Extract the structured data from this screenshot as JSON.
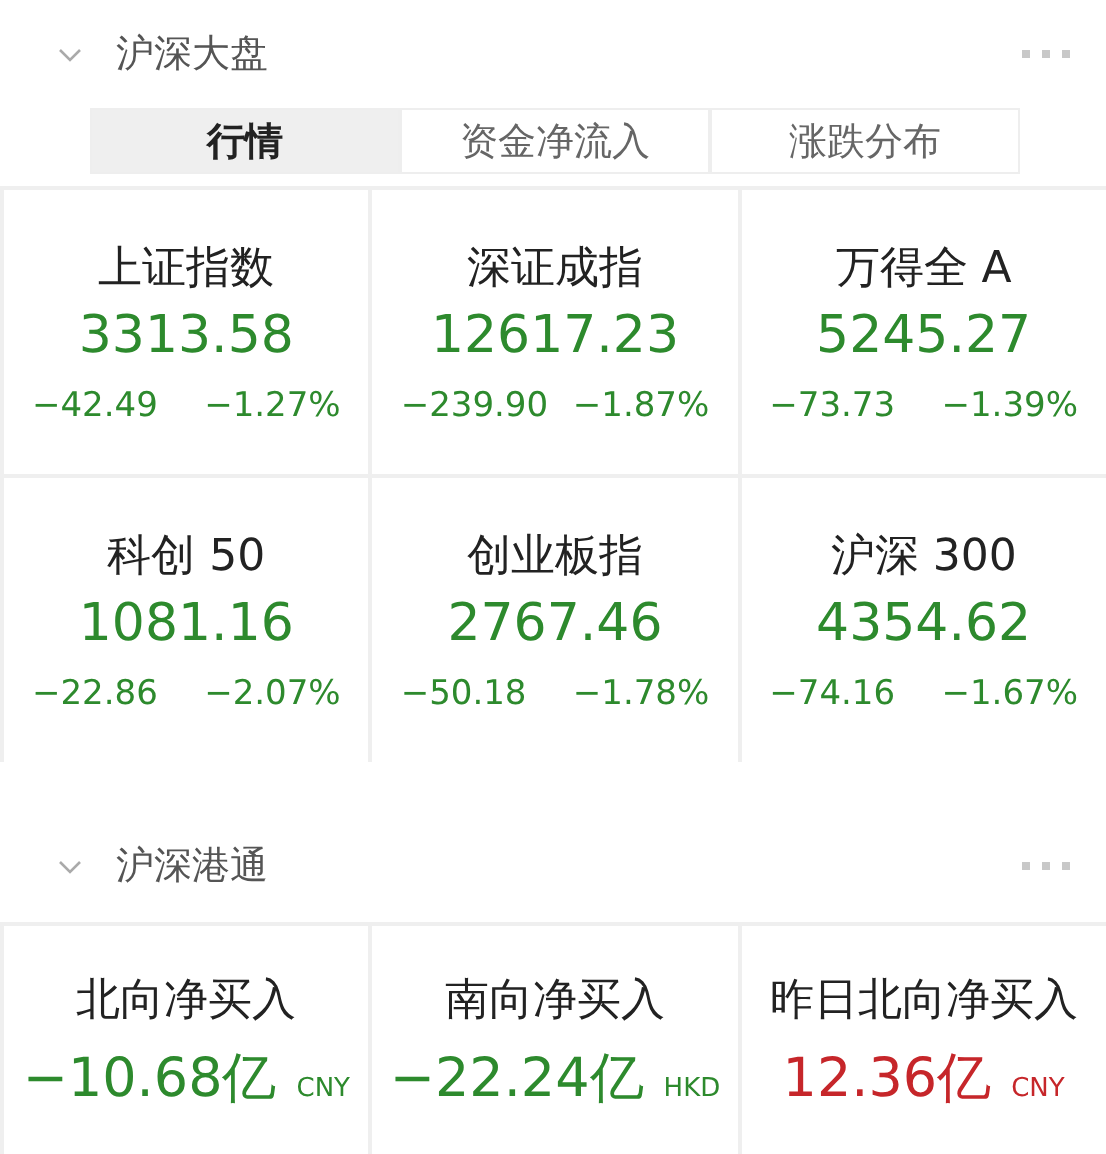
{
  "market": {
    "title": "沪深大盘",
    "expanded": true,
    "tabs": [
      {
        "label": "行情",
        "selected": true
      },
      {
        "label": "资金净流入",
        "selected": false
      },
      {
        "label": "涨跌分布",
        "selected": false
      }
    ],
    "indices": [
      {
        "name": "上证指数",
        "value": "3313.58",
        "change": "−42.49",
        "percent": "−1.27%",
        "color": "#2d8a2d"
      },
      {
        "name": "深证成指",
        "value": "12617.23",
        "change": "−239.90",
        "percent": "−1.87%",
        "color": "#2d8a2d"
      },
      {
        "name": "万得全 A",
        "value": "5245.27",
        "change": "−73.73",
        "percent": "−1.39%",
        "color": "#2d8a2d"
      },
      {
        "name": "科创 50",
        "value": "1081.16",
        "change": "−22.86",
        "percent": "−2.07%",
        "color": "#2d8a2d"
      },
      {
        "name": "创业板指",
        "value": "2767.46",
        "change": "−50.18",
        "percent": "−1.78%",
        "color": "#2d8a2d"
      },
      {
        "name": "沪深 300",
        "value": "4354.62",
        "change": "−74.16",
        "percent": "−1.67%",
        "color": "#2d8a2d"
      }
    ]
  },
  "connect": {
    "title": "沪深港通",
    "expanded": true,
    "flows": [
      {
        "name": "北向净买入",
        "value": "−10.68亿",
        "currency": "CNY",
        "color": "#2d8a2d"
      },
      {
        "name": "南向净买入",
        "value": "−22.24亿",
        "currency": "HKD",
        "color": "#2d8a2d"
      },
      {
        "name": "昨日北向净买入",
        "value": "12.36亿",
        "currency": "CNY",
        "color": "#c6262a"
      }
    ]
  }
}
